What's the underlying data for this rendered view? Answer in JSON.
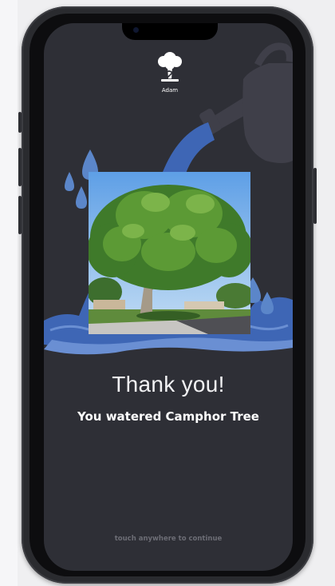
{
  "app": {
    "brand_name": "Adam"
  },
  "message": {
    "title": "Thank you!",
    "subtitle": "You watered Camphor Tree",
    "hint": "touch anywhere to continue"
  },
  "photo": {
    "subject": "Camphor Tree"
  },
  "icons": {
    "logo": "tree-logo-icon",
    "watering_can": "watering-can-icon",
    "water_drop": "water-drop-icon"
  },
  "colors": {
    "screen_background": "#2e2f36",
    "water_blue": "#3e66b5",
    "drop_blue": "#5b86c9",
    "watering_can": "#3f3f49",
    "text_primary": "#ffffff",
    "text_hint": "#6c6d75"
  }
}
